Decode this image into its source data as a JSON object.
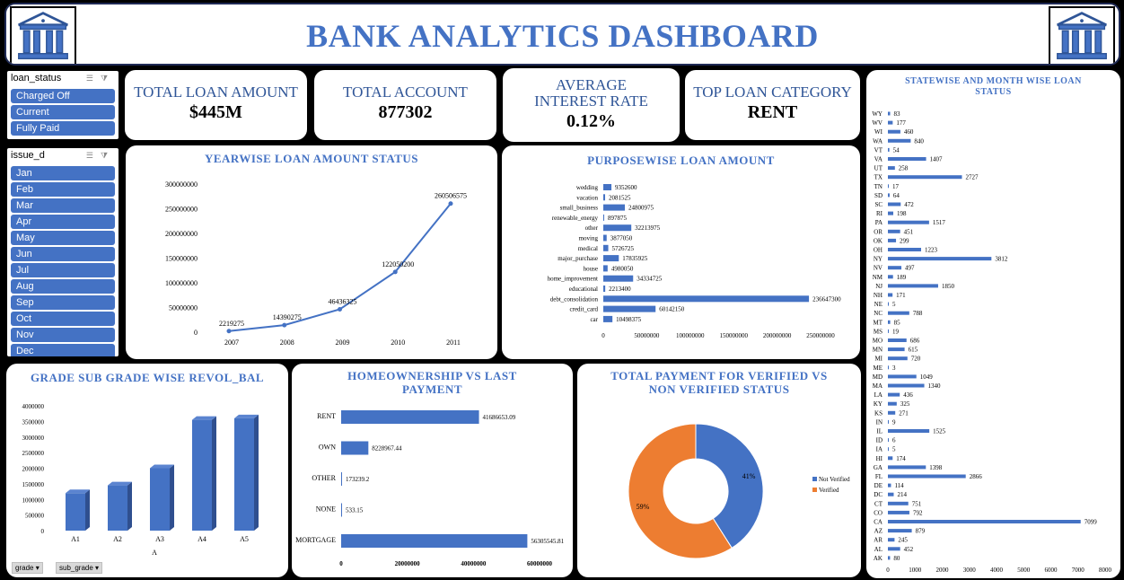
{
  "header": {
    "title": "BANK ANALYTICS DASHBOARD"
  },
  "slicers": {
    "loan_status": {
      "title": "loan_status",
      "items": [
        "Charged Off",
        "Current",
        "Fully Paid"
      ]
    },
    "issue_d": {
      "title": "issue_d",
      "items": [
        "Jan",
        "Feb",
        "Mar",
        "Apr",
        "May",
        "Jun",
        "Jul",
        "Aug",
        "Sep",
        "Oct",
        "Nov",
        "Dec"
      ]
    }
  },
  "kpis": {
    "total_loan": {
      "label": "TOTAL LOAN AMOUNT",
      "value": "$445M"
    },
    "total_account": {
      "label": "TOTAL ACCOUNT",
      "value": "877302"
    },
    "avg_interest": {
      "label": "AVERAGE INTEREST RATE",
      "value": "0.12%"
    },
    "top_category": {
      "label": "TOP LOAN CATEGORY",
      "value": "RENT"
    }
  },
  "colors": {
    "primary": "#4472c4",
    "orange": "#ed7d31",
    "title_blue": "#4472c4",
    "background": "#000000"
  },
  "filters": {
    "grade": "grade",
    "sub_grade": "sub_grade"
  },
  "chart_data": [
    {
      "id": "yearwise",
      "type": "line",
      "title": "YEARWISE LOAN AMOUNT STATUS",
      "x": [
        "2007",
        "2008",
        "2009",
        "2010",
        "2011"
      ],
      "values": [
        2219275,
        14390275,
        46436325,
        122050200,
        260506575
      ],
      "labels": [
        "2219275",
        "14390275",
        "46436325",
        "122050200",
        "260506575"
      ],
      "ylim": [
        0,
        300000000
      ],
      "yticks": [
        0,
        50000000,
        100000000,
        150000000,
        200000000,
        250000000,
        300000000
      ]
    },
    {
      "id": "purposewise",
      "type": "bar",
      "title": "PURPOSEWISE LOAN AMOUNT",
      "categories": [
        "wedding",
        "vacation",
        "small_business",
        "renewable_energy",
        "other",
        "moving",
        "medical",
        "major_purchase",
        "house",
        "home_improvement",
        "educational",
        "debt_consolidation",
        "credit_card",
        "car"
      ],
      "values": [
        9352600,
        2081525,
        24800975,
        897875,
        32213975,
        3877050,
        5726725,
        17835925,
        4980050,
        34334725,
        2213400,
        236647300,
        60142150,
        10498375
      ],
      "xlim": [
        0,
        250000000
      ],
      "xticks": [
        0,
        50000000,
        100000000,
        150000000,
        200000000,
        250000000
      ]
    },
    {
      "id": "statewise",
      "type": "bar",
      "title": "STATEWISE AND MONTH WISE LOAN STATUS",
      "categories": [
        "WY",
        "WV",
        "WI",
        "WA",
        "VT",
        "VA",
        "UT",
        "TX",
        "TN",
        "SD",
        "SC",
        "RI",
        "PA",
        "OR",
        "OK",
        "OH",
        "NY",
        "NV",
        "NM",
        "NJ",
        "NH",
        "NE",
        "NC",
        "MT",
        "MS",
        "MO",
        "MN",
        "MI",
        "ME",
        "MD",
        "MA",
        "LA",
        "KY",
        "KS",
        "IN",
        "IL",
        "ID",
        "IA",
        "HI",
        "GA",
        "FL",
        "DE",
        "DC",
        "CT",
        "CO",
        "CA",
        "AZ",
        "AR",
        "AL",
        "AK"
      ],
      "values": [
        83,
        177,
        460,
        840,
        54,
        1407,
        258,
        2727,
        17,
        64,
        472,
        198,
        1517,
        451,
        299,
        1223,
        3812,
        497,
        189,
        1850,
        171,
        5,
        788,
        85,
        19,
        686,
        615,
        720,
        3,
        1049,
        1340,
        436,
        325,
        271,
        9,
        1525,
        6,
        5,
        174,
        1398,
        2866,
        114,
        214,
        751,
        792,
        7099,
        879,
        245,
        452,
        80
      ],
      "xlim": [
        0,
        8000
      ],
      "xticks": [
        0,
        1000,
        2000,
        3000,
        4000,
        5000,
        6000,
        7000,
        8000
      ]
    },
    {
      "id": "grade",
      "type": "bar",
      "title": "GRADE SUB GRADE WISE REVOL_BAL",
      "categories": [
        "A1",
        "A2",
        "A3",
        "A4",
        "A5"
      ],
      "group_label": "A",
      "values": [
        1200000,
        1450000,
        2000000,
        3550000,
        3600000
      ],
      "ylim": [
        0,
        4000000
      ],
      "yticks": [
        0,
        500000,
        1000000,
        1500000,
        2000000,
        2500000,
        3000000,
        3500000,
        4000000
      ]
    },
    {
      "id": "homeownership",
      "type": "bar",
      "title": "HOMEOWNERSHIP VS LAST PAYMENT",
      "categories": [
        "RENT",
        "OWN",
        "OTHER",
        "NONE",
        "MORTGAGE"
      ],
      "values": [
        41686653.09,
        8228967.44,
        173239.2,
        533.15,
        56305545.81
      ],
      "labels": [
        "41686653.09",
        "8228967.44",
        "173239.2",
        "533.15",
        "56305545.81"
      ],
      "xlim": [
        0,
        60000000
      ],
      "xticks": [
        0,
        20000000,
        40000000,
        60000000
      ]
    },
    {
      "id": "verified",
      "type": "pie",
      "title": "TOTAL PAYMENT FOR VERIFIED VS NON VERIFIED STATUS",
      "series": [
        {
          "name": "Not Verified",
          "value": 41,
          "label": "41%",
          "color": "#4472c4"
        },
        {
          "name": "Verified",
          "value": 59,
          "label": "59%",
          "color": "#ed7d31"
        }
      ]
    }
  ]
}
